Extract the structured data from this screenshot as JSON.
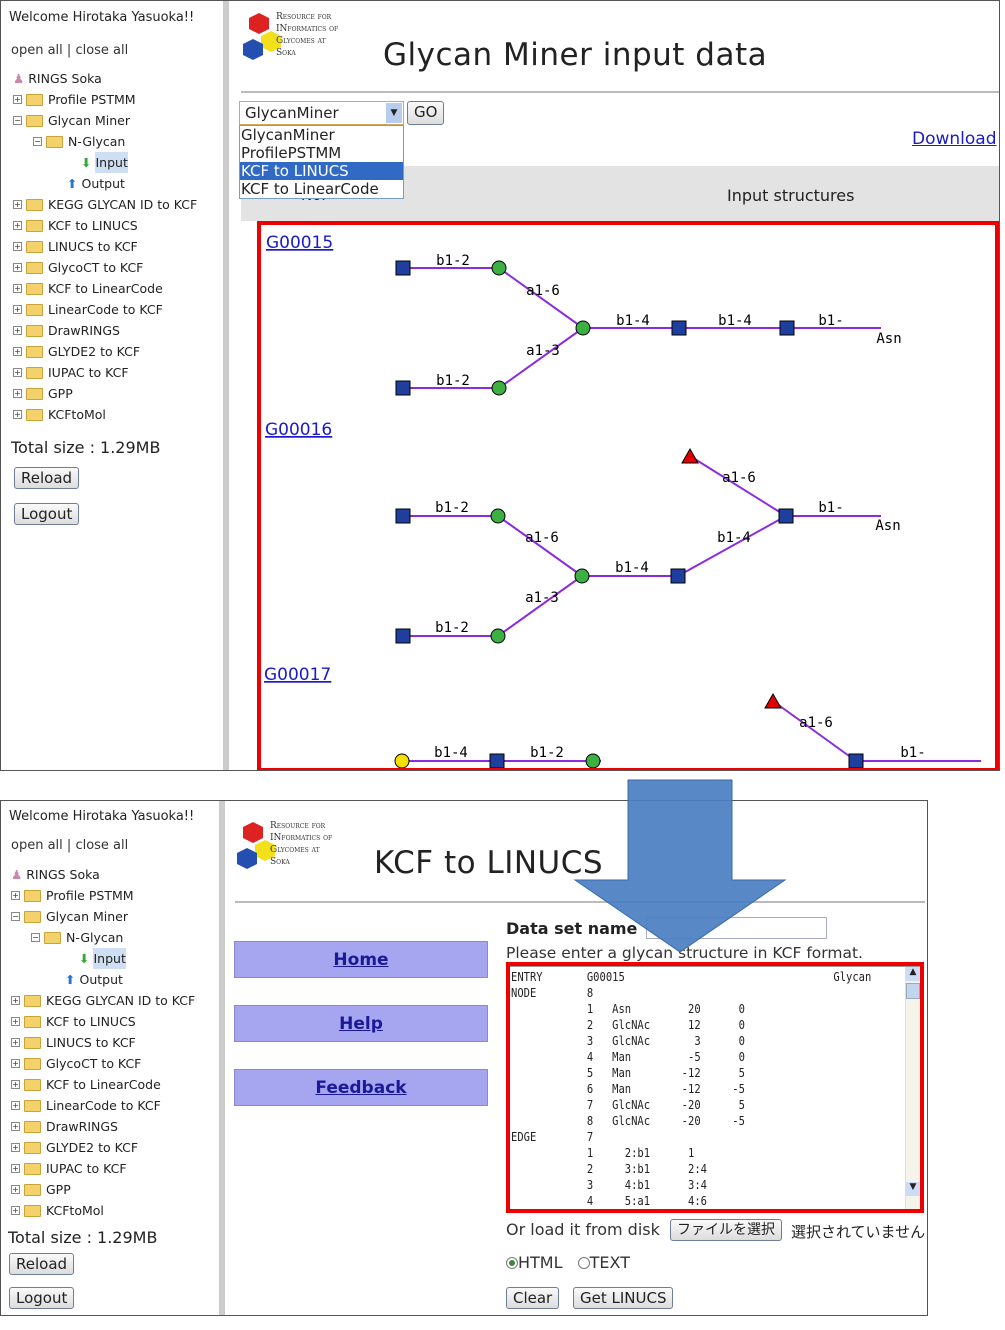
{
  "sidebar": {
    "welcome": "Welcome Hirotaka Yasuoka!!",
    "open_all": "open all",
    "sep": "|",
    "close_all": "close all",
    "items": [
      {
        "label": "RINGS Soka",
        "level": 0,
        "type": "user"
      },
      {
        "label": "Profile PSTMM",
        "level": 0,
        "type": "folder"
      },
      {
        "label": "Glycan Miner",
        "level": 0,
        "type": "folder-open"
      },
      {
        "label": "N-Glycan",
        "level": 1,
        "type": "folder-open"
      },
      {
        "label": "Input",
        "level": 2,
        "type": "input",
        "selected": true
      },
      {
        "label": "Output",
        "level": 2,
        "type": "output"
      },
      {
        "label": "KEGG GLYCAN ID to KCF",
        "level": 0,
        "type": "folder"
      },
      {
        "label": "KCF to LINUCS",
        "level": 0,
        "type": "folder"
      },
      {
        "label": "LINUCS to KCF",
        "level": 0,
        "type": "folder"
      },
      {
        "label": "GlycoCT to KCF",
        "level": 0,
        "type": "folder"
      },
      {
        "label": "KCF to LinearCode",
        "level": 0,
        "type": "folder"
      },
      {
        "label": "LinearCode to KCF",
        "level": 0,
        "type": "folder"
      },
      {
        "label": "DrawRINGS",
        "level": 0,
        "type": "folder"
      },
      {
        "label": "GLYDE2 to KCF",
        "level": 0,
        "type": "folder"
      },
      {
        "label": "IUPAC to KCF",
        "level": 0,
        "type": "folder"
      },
      {
        "label": "GPP",
        "level": 0,
        "type": "folder"
      },
      {
        "label": "KCFtoMol",
        "level": 0,
        "type": "folder"
      }
    ],
    "total_size": "Total size : 1.29MB",
    "reload": "Reload",
    "logout": "Logout"
  },
  "logo": {
    "lines": [
      "Resource for",
      "INformatics of",
      "Glycomes at",
      "Soka"
    ]
  },
  "top": {
    "title": "Glycan Miner input data",
    "select_value": "GlycanMiner",
    "go": "GO",
    "options": [
      "GlycanMiner",
      "ProfilePSTMM",
      "KCF to LINUCS",
      "KCF to LinearCode"
    ],
    "highlighted_option": "KCF to LINUCS",
    "download": "Download",
    "col_no": "No.",
    "col_structures": "Input structures",
    "glycans": [
      {
        "id": "G00015",
        "labels": [
          "b1-2",
          "a1-6",
          "b1-4",
          "b1-4",
          "b1-",
          "a1-3",
          "b1-2"
        ],
        "root": "Asn"
      },
      {
        "id": "G00016",
        "labels": [
          "a1-6",
          "b1-",
          "b1-2",
          "a1-6",
          "b1-4",
          "b1-4",
          "a1-3",
          "b1-2"
        ],
        "root": "Asn"
      },
      {
        "id": "G00017",
        "labels": [
          "a1-6",
          "b1-",
          "b1-4",
          "b1-2"
        ]
      }
    ]
  },
  "bottom": {
    "title": "KCF to LINUCS",
    "nav": [
      "Home",
      "Help",
      "Feedback"
    ],
    "dataset_label": "Data set name",
    "dataset_value": "",
    "prompt": "Please enter a glycan structure in KCF format.",
    "kcf": "ENTRY       G00015                                 Glycan\nNODE        8\n            1   Asn         20      0\n            2   GlcNAc      12      0\n            3   GlcNAc       3      0\n            4   Man         -5      0\n            5   Man        -12      5\n            6   Man        -12     -5\n            7   GlcNAc     -20      5\n            8   GlcNAc     -20     -5\nEDGE        7\n            1     2:b1      1\n            2     3:b1      2:4\n            3     4:b1      3:4\n            4     5:a1      4:6",
    "load_label": "Or load it from disk",
    "file_button": "ファイルを選択",
    "file_status": "選択されていません",
    "format_html": "HTML",
    "format_text": "TEXT",
    "format_selected": "HTML",
    "clear": "Clear",
    "submit": "Get LINUCS"
  },
  "colors": {
    "highlight_red": "#e00000",
    "arrow_blue": "#4a7fc1",
    "nav_button": "#a6a6f0",
    "link_blue": "#1a1acc",
    "glycan_line": "#8a2be2",
    "glcnac_square": "#1f3f9f",
    "man_circle": "#3cb043",
    "fuc_triangle": "#e00000",
    "gal_circle": "#f5e000"
  }
}
